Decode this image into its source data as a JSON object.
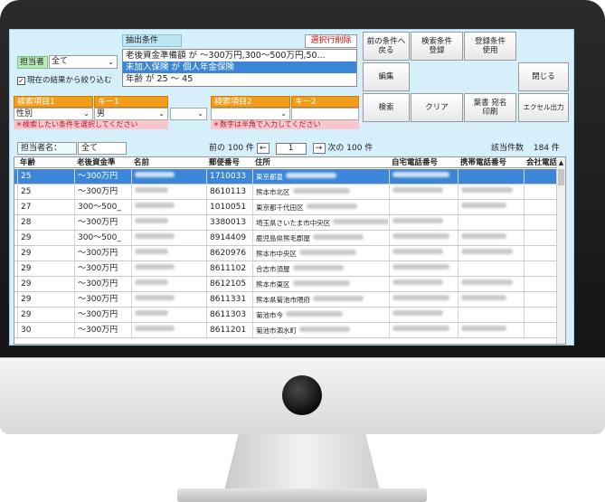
{
  "filters": {
    "condition_label": "抽出条件",
    "delete_row_label": "選択行削除",
    "conditions": [
      "老後資金準備額 が ～300万円,300～500万円,50...",
      "未加入保険 が 個人年金保険",
      "年齢 が 25 ～ 45"
    ],
    "selected_condition_index": 1,
    "tanto_label": "担当者",
    "tanto_value": "全て",
    "narrow_checked": true,
    "narrow_label": "現在の結果から絞り込む"
  },
  "search_keys": {
    "item1_label": "検索項目1",
    "key1_label": "キー1",
    "item1_value": "性別",
    "key1_value": "男",
    "item2_label": "検索項目2",
    "key2_label": "キー2",
    "item2_value": "",
    "key2_value": "",
    "note1": "＊検索したい条件を選択してください",
    "note2": "＊数字は半角で入力してください"
  },
  "buttons": {
    "prev_condition": "前の条件へ\n戻る",
    "save_condition": "検索条件\n登録",
    "use_condition": "登録条件\n使用",
    "edit": "編集",
    "close": "閉じる",
    "search": "検索",
    "clear": "クリア",
    "print_address": "葉書 宛名\n印刷",
    "excel": "エクセル出力"
  },
  "status": {
    "tanto_name_label": "担当者名：",
    "tanto_name_value": "全て",
    "prev_100": "前の 100 件",
    "page": "1",
    "next_100": "次の 100 件",
    "count_label": "該当件数",
    "count_value": "184 件"
  },
  "table": {
    "columns": [
      "年齢",
      "老後資金準",
      "名前",
      "郵便番号",
      "住所",
      "自宅電話番号",
      "携帯電話番号",
      "会社電話"
    ],
    "rows": [
      {
        "age": "25",
        "fund": "～300万円",
        "zip": "1710033",
        "addr": "東京都豊"
      },
      {
        "age": "25",
        "fund": "～300万円",
        "zip": "8610113",
        "addr": "熊本市北区"
      },
      {
        "age": "27",
        "fund": "300～500_",
        "zip": "1010051",
        "addr": "東京都千代田区"
      },
      {
        "age": "28",
        "fund": "～300万円",
        "zip": "3380013",
        "addr": "埼玉県さいたま市中央区"
      },
      {
        "age": "29",
        "fund": "300～500_",
        "zip": "8914409",
        "addr": "鹿児島県熊毛郡屋"
      },
      {
        "age": "29",
        "fund": "～300万円",
        "zip": "8620976",
        "addr": "熊本市中央区"
      },
      {
        "age": "29",
        "fund": "～300万円",
        "zip": "8611102",
        "addr": "合志市須屋"
      },
      {
        "age": "29",
        "fund": "～300万円",
        "zip": "8612105",
        "addr": "熊本市東区"
      },
      {
        "age": "29",
        "fund": "～300万円",
        "zip": "8611331",
        "addr": "熊本県菊池市隈府"
      },
      {
        "age": "29",
        "fund": "～300万円",
        "zip": "8611303",
        "addr": "菊池市今"
      },
      {
        "age": "30",
        "fund": "～300万円",
        "zip": "8611201",
        "addr": "菊池市泗水町"
      }
    ],
    "selected_row_index": 0
  },
  "colors": {
    "screen_bg": "#d5f0fa",
    "selection": "#3b86d8",
    "key_header": "#f39c1a",
    "note_bg": "#f7c7cd",
    "note_text": "#c0142a",
    "delete_text": "#d01010"
  }
}
